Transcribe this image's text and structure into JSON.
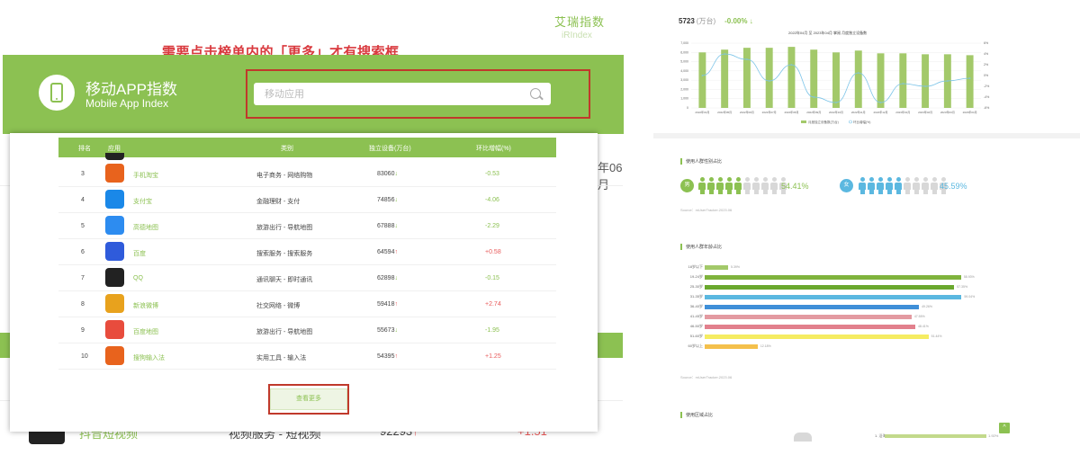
{
  "site": {
    "brand_cn": "艾瑞指数",
    "brand_en": "iRIndex"
  },
  "annotation_top": "需要点击榜单内的「更多」才有搜索框",
  "banner": {
    "title": "移动APP指数",
    "subtitle": "Mobile App Index",
    "search_placeholder": "移动应用"
  },
  "background": {
    "year_fragment": "年06月",
    "row": {
      "name": "抖音短视频",
      "category": "视频服务 - 短视频",
      "value": "92293",
      "change": "+1.51"
    }
  },
  "table": {
    "headers": {
      "rank": "排名",
      "app": "应用",
      "category": "类别",
      "devices": "独立设备(万台)",
      "change": "环比增幅(%)"
    },
    "rows": [
      {
        "rank": "3",
        "name": "手机淘宝",
        "category": "电子商务 - 网络购物",
        "value": "83060",
        "trend": "down",
        "change": "-0.53",
        "icon": "taobao-icon",
        "color": "#e8631d"
      },
      {
        "rank": "4",
        "name": "支付宝",
        "category": "金融理财 - 支付",
        "value": "74856",
        "trend": "down",
        "change": "-4.06",
        "icon": "alipay-icon",
        "color": "#1a88e8"
      },
      {
        "rank": "5",
        "name": "高德地图",
        "category": "旅游出行 - 导航地图",
        "value": "67888",
        "trend": "down",
        "change": "-2.29",
        "icon": "amap-icon",
        "color": "#2d8cf0"
      },
      {
        "rank": "6",
        "name": "百度",
        "category": "搜索服务 - 搜索服务",
        "value": "64594",
        "trend": "up",
        "change": "+0.58",
        "icon": "baidu-icon",
        "color": "#2f5bdb"
      },
      {
        "rank": "7",
        "name": "QQ",
        "category": "通讯聊天 - 即时通讯",
        "value": "62898",
        "trend": "down",
        "change": "-0.15",
        "icon": "qq-icon",
        "color": "#222222"
      },
      {
        "rank": "8",
        "name": "新浪微博",
        "category": "社交网络 - 微博",
        "value": "59418",
        "trend": "up",
        "change": "+2.74",
        "icon": "weibo-icon",
        "color": "#e8a21d"
      },
      {
        "rank": "9",
        "name": "百度地图",
        "category": "旅游出行 - 导航地图",
        "value": "55673",
        "trend": "down",
        "change": "-1.95",
        "icon": "baidu-map-icon",
        "color": "#e84c3d"
      },
      {
        "rank": "10",
        "name": "搜狗输入法",
        "category": "实用工具 - 输入法",
        "value": "54395",
        "trend": "up",
        "change": "+1.25",
        "icon": "sogou-icon",
        "color": "#e8631d"
      }
    ],
    "more_button": "查看更多"
  },
  "right_panel": {
    "kpi_value": "5723",
    "kpi_unit": "(万台)",
    "kpi_change": "-0.00%",
    "kpi_trend": "down",
    "chart_title": "2022年04月 至 2023年04月 掌阅 月度独立设备数",
    "gender": {
      "title": "使用人群性别占比",
      "male_label": "男",
      "male_pct": "54.41%",
      "male_share": 0.5441,
      "female_label": "女",
      "female_pct": "45.59%",
      "female_share": 0.4559,
      "source": "Source：mUserTracker.2023.06"
    },
    "age": {
      "title": "使用人群年龄占比",
      "groups": [
        {
          "label": "18岁以下",
          "pct": 5.39,
          "color": "#a3c96a"
        },
        {
          "label": "19-24岁",
          "pct": 58.93,
          "color": "#7fb33d"
        },
        {
          "label": "25-30岁",
          "pct": 57.35,
          "color": "#6aa82e"
        },
        {
          "label": "31-35岁",
          "pct": 59.04,
          "color": "#5bb8e0"
        },
        {
          "label": "36-40岁",
          "pct": 49.26,
          "color": "#3f8fd8"
        },
        {
          "label": "41-45岁",
          "pct": 47.55,
          "color": "#e39aa1"
        },
        {
          "label": "46-50岁",
          "pct": 48.41,
          "color": "#e2808d"
        },
        {
          "label": "51-60岁",
          "pct": 51.44,
          "color": "#f5ec62"
        },
        {
          "label": "60岁以上",
          "pct": 12.18,
          "color": "#f4c04c"
        }
      ],
      "source": "Source：mUserTracker.2023.06"
    },
    "region": {
      "title": "使用区域占比",
      "first_label": "1. 沿海",
      "first_val": "1.92%"
    }
  },
  "chart_data": {
    "type": "bar",
    "title": "2022年04月 至 2023年04月 掌阅 月度独立设备数",
    "categories": [
      "2022年04月",
      "2022年05月",
      "2022年06月",
      "2022年07月",
      "2022年08月",
      "2022年09月",
      "2022年10月",
      "2022年11月",
      "2022年12月",
      "2023年01月",
      "2023年02月",
      "2023年03月",
      "2023年04月"
    ],
    "series": [
      {
        "name": "月度独立设备数(万台)",
        "type": "bar",
        "values": [
          6000,
          6300,
          6500,
          6500,
          6600,
          6300,
          6000,
          6200,
          5900,
          5900,
          5800,
          5800,
          5700
        ]
      },
      {
        "name": "环比增幅(%)",
        "type": "line",
        "axis": "right",
        "values": [
          0.0,
          4.0,
          3.0,
          -1.0,
          2.0,
          -4.0,
          -5.0,
          0.5,
          -5.0,
          -1.5,
          -2.0,
          -1.0,
          -0.5
        ]
      }
    ],
    "ylim": [
      0,
      7000
    ],
    "y2lim": [
      -6,
      6
    ],
    "yticks": [
      "0",
      "1,000",
      "2,000",
      "3,000",
      "4,000",
      "5,000",
      "6,000",
      "7,000"
    ],
    "y2ticks": [
      "-6%",
      "-4%",
      "-2%",
      "0%",
      "2%",
      "4%",
      "6%"
    ],
    "legend_position": "bottom"
  }
}
